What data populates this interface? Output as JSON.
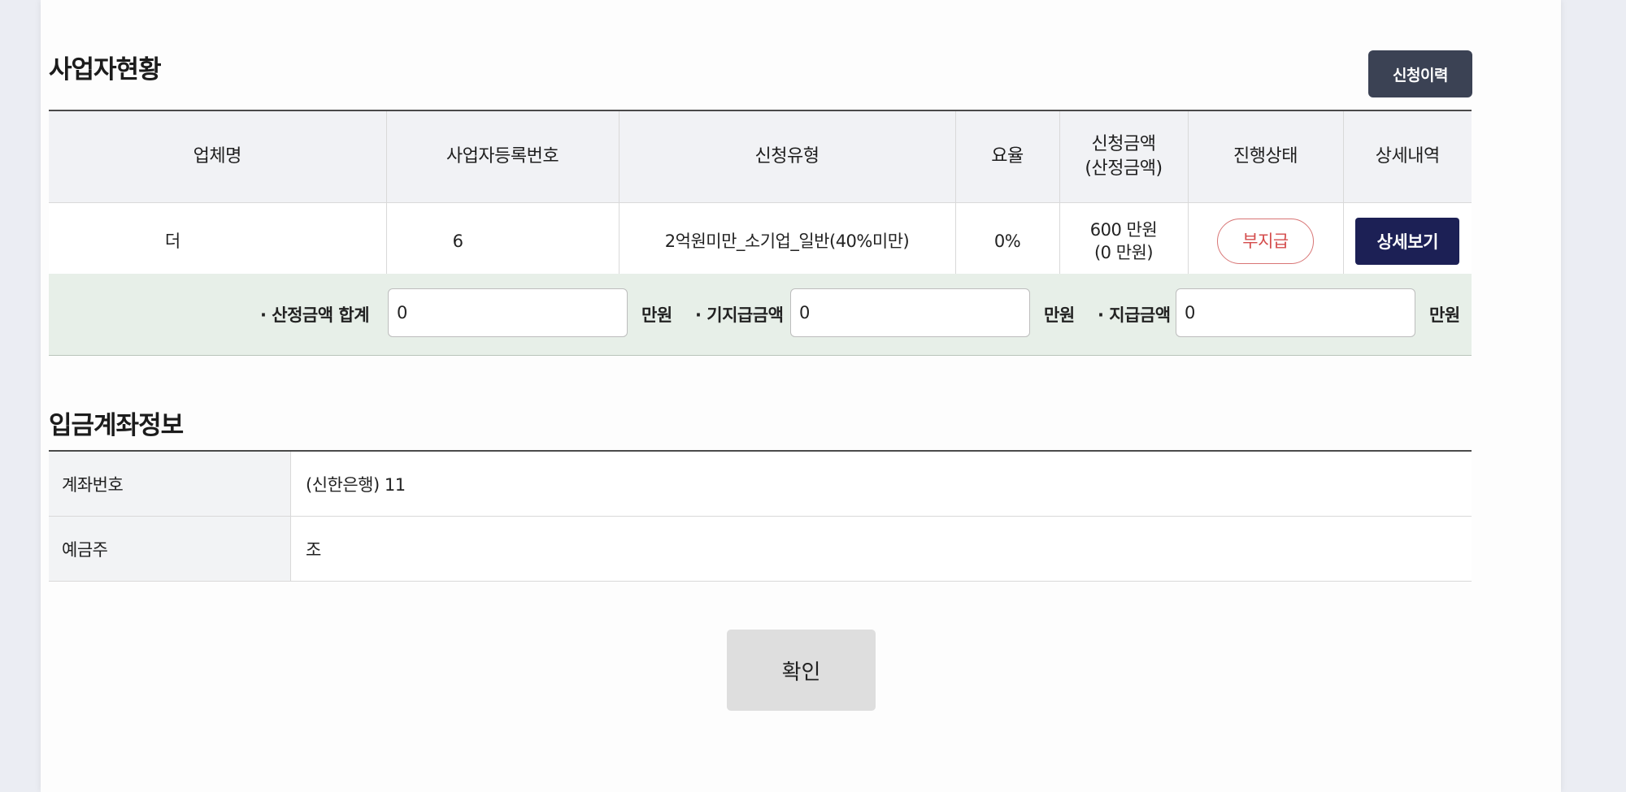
{
  "business_section": {
    "title": "사업자현황",
    "history_button": "신청이력",
    "columns": [
      "업체명",
      "사업자등록번호",
      "신청유형",
      "요율",
      "신청금액",
      "(산정금액)",
      "진행상태",
      "상세내역"
    ],
    "row": {
      "company_name": "더",
      "registration_number": "6",
      "application_type": "2억원미만_소기업_일반(40%미만)",
      "rate": "0%",
      "amount": "600 만원",
      "assessed_amount": "(0 만원)",
      "status": "부지급",
      "detail_button": "상세보기"
    }
  },
  "summary": {
    "assessed_total_label": "· 산정금액 합계",
    "assessed_total_value": "0",
    "paid_label": "· 기지급금액",
    "paid_value": "0",
    "payment_label": "· 지급금액",
    "payment_value": "0",
    "unit": "만원"
  },
  "account_section": {
    "title": "입금계좌정보",
    "account_number_label": "계좌번호",
    "account_number_value": "(신한은행) 11",
    "holder_label": "예금주",
    "holder_value": "조"
  },
  "confirm_button": "확인",
  "colors": {
    "history_button_bg": "#3b4254",
    "detail_button_bg": "#1c2055",
    "status_red": "#d44c4c",
    "summary_bg": "#e7efe8"
  }
}
